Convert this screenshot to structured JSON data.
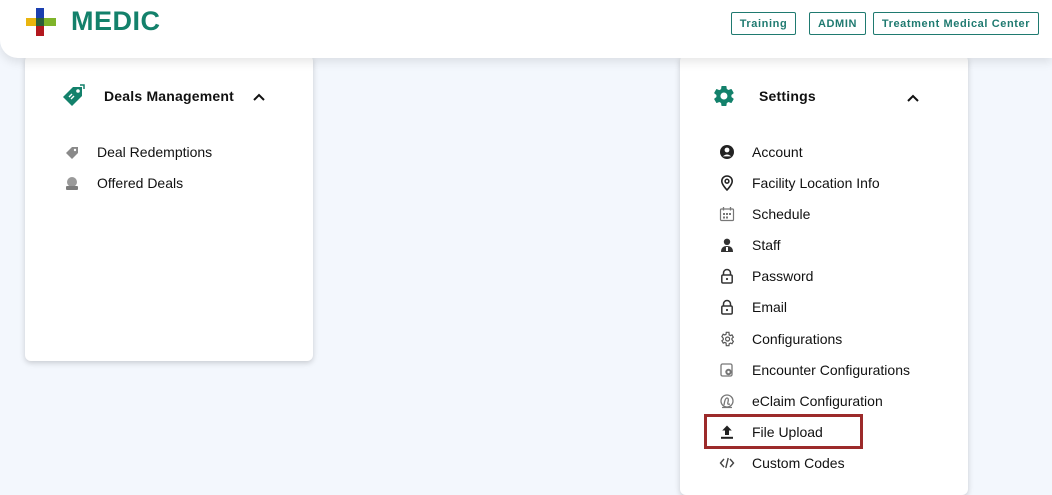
{
  "header": {
    "brand": "MEDIC",
    "tags": [
      "Training",
      "ADMIN",
      "Treatment Medical Center"
    ]
  },
  "deals": {
    "title": "Deals Management",
    "items": [
      {
        "label": "Deal Redemptions",
        "icon": "tag-icon"
      },
      {
        "label": "Offered Deals",
        "icon": "stamp-icon"
      }
    ]
  },
  "settings": {
    "title": "Settings",
    "items": [
      {
        "label": "Account",
        "icon": "user-circle-icon"
      },
      {
        "label": "Facility Location Info",
        "icon": "location-pin-icon"
      },
      {
        "label": "Schedule",
        "icon": "calendar-icon"
      },
      {
        "label": "Staff",
        "icon": "staff-icon"
      },
      {
        "label": "Password",
        "icon": "lock-icon"
      },
      {
        "label": "Email",
        "icon": "lock-icon"
      },
      {
        "label": "Configurations",
        "icon": "gear-icon"
      },
      {
        "label": "Encounter Configurations",
        "icon": "encounter-config-icon"
      },
      {
        "label": "eClaim Configuration",
        "icon": "eclaim-icon"
      },
      {
        "label": "File Upload",
        "icon": "upload-icon"
      },
      {
        "label": "Custom Codes",
        "icon": "code-icon"
      }
    ]
  },
  "colors": {
    "brand": "#13816b",
    "tag_border": "#1f7a70",
    "highlight": "#9c2a2a",
    "background": "#f3f7fd"
  }
}
